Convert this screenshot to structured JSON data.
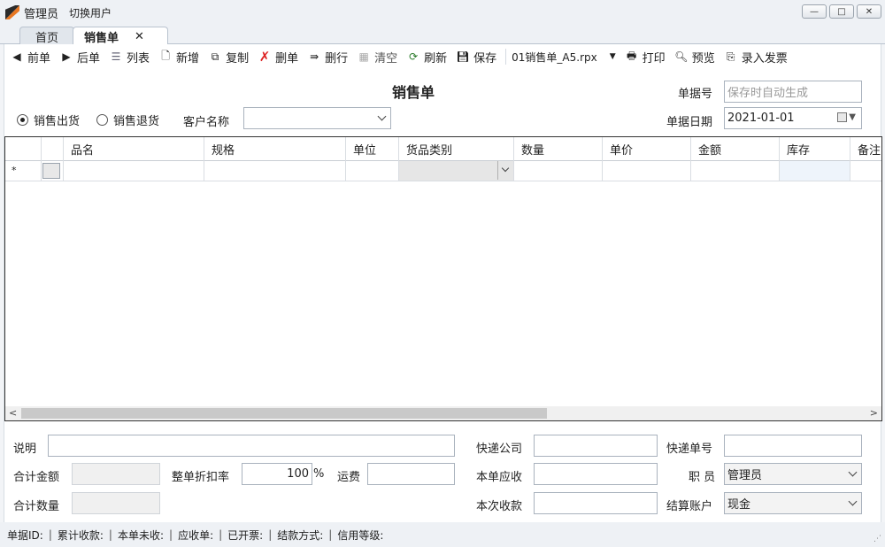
{
  "window": {
    "user": "管理员",
    "switch_user": "切换用户",
    "buttons": [
      "—",
      "□",
      "✕"
    ]
  },
  "tabs": [
    {
      "label": "首页",
      "active": false
    },
    {
      "label": "销售单",
      "active": true,
      "close": "✕"
    }
  ],
  "toolbar": {
    "prev": "前单",
    "next": "后单",
    "list": "列表",
    "add": "新增",
    "copy": "复制",
    "delete": "删单",
    "delete_row": "删行",
    "clear": "清空",
    "refresh": "刷新",
    "save": "保存",
    "template": "01销售单_A5.rpx",
    "print": "打印",
    "preview": "预览",
    "invoice": "录入发票"
  },
  "form": {
    "title": "销售单",
    "doc_no_label": "单据号",
    "doc_no_placeholder": "保存时自动生成",
    "radio_out": "销售出货",
    "radio_return": "销售退货",
    "customer_label": "客户名称",
    "customer_value": "",
    "date_label": "单据日期",
    "date_value": "2021-01-01"
  },
  "grid": {
    "columns": [
      "品名",
      "规格",
      "单位",
      "货品类别",
      "数量",
      "单价",
      "金额",
      "库存",
      "备注"
    ],
    "new_row_marker": "*"
  },
  "bottom": {
    "note_label": "说明",
    "express_company_label": "快递公司",
    "express_no_label": "快递单号",
    "total_amount_label": "合计金额",
    "discount_label": "整单折扣率",
    "discount_value": "100",
    "percent": "%",
    "freight_label": "运费",
    "receivable_label": "本单应收",
    "staff_label": "职 员",
    "staff_value": "管理员",
    "total_qty_label": "合计数量",
    "received_label": "本次收款",
    "account_label": "结算账户",
    "account_value": "现金"
  },
  "status": {
    "items": [
      "单据ID:",
      "累计收款:",
      "本单未收:",
      "应收单:",
      "已开票:",
      "结款方式:",
      "信用等级:"
    ]
  }
}
